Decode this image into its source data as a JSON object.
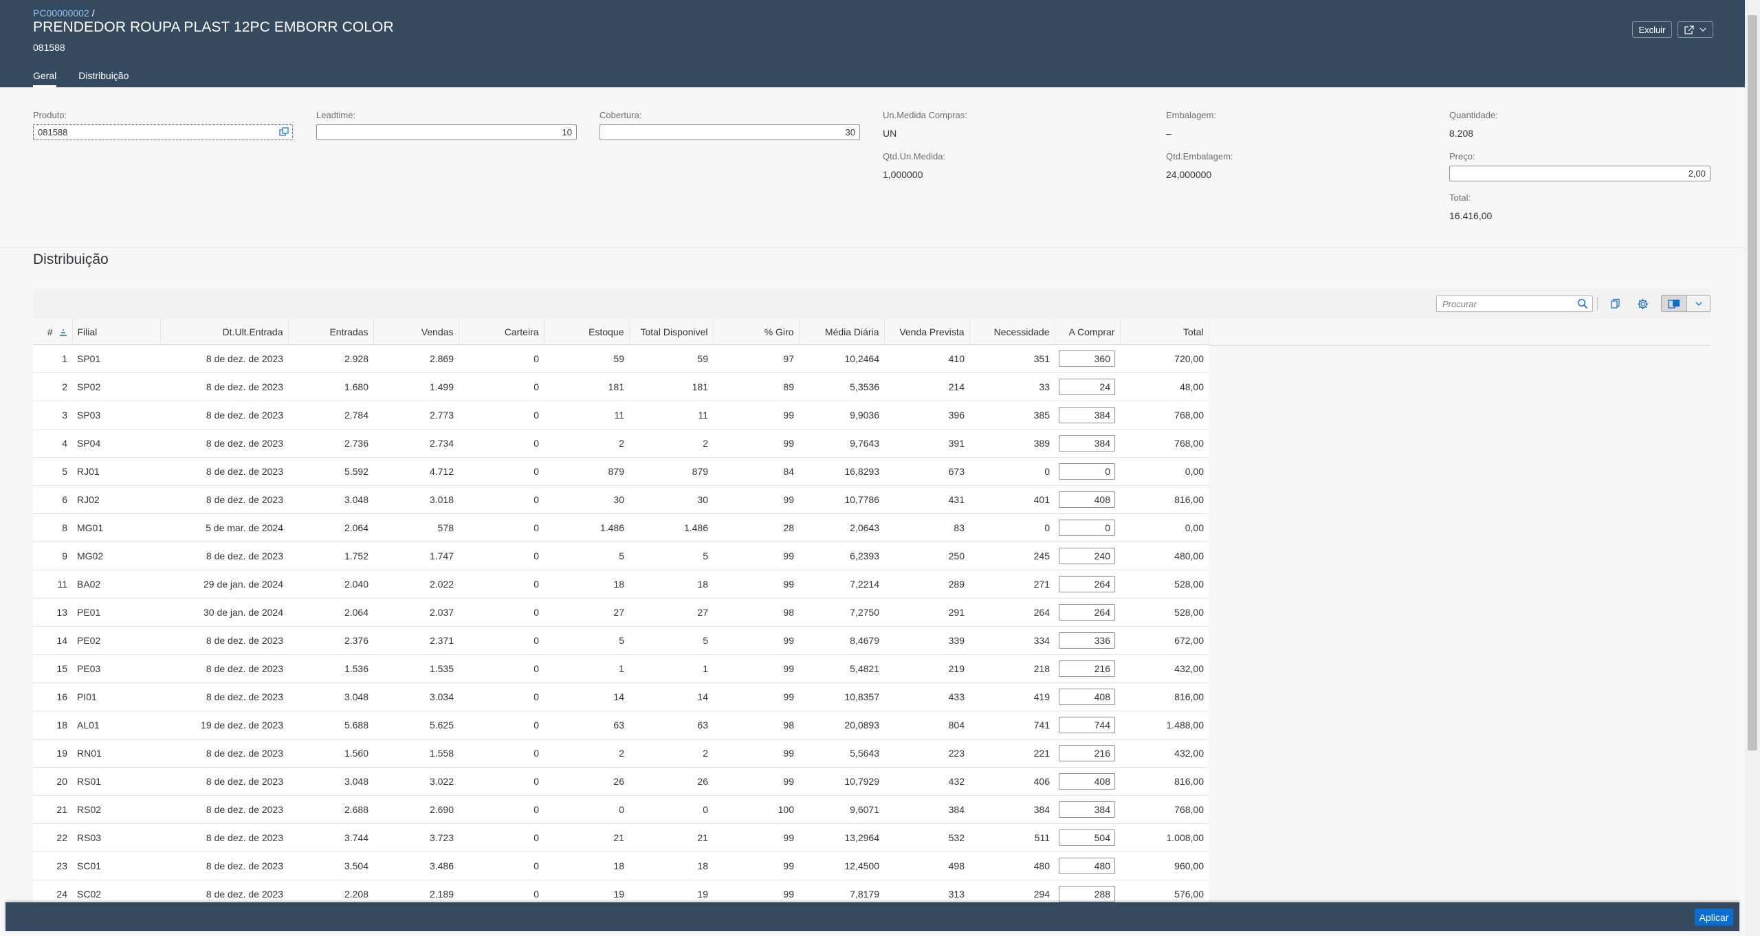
{
  "header": {
    "breadcrumb_link": "PC00000002",
    "breadcrumb_sep": "/",
    "title": "PRENDEDOR ROUPA PLAST 12PC EMBORR COLOR",
    "subtitle": "081588",
    "delete_label": "Excluir",
    "tabs": [
      {
        "label": "Geral"
      },
      {
        "label": "Distribuição"
      }
    ]
  },
  "form": {
    "produto": {
      "label": "Produto:",
      "value": "081588"
    },
    "leadtime": {
      "label": "Leadtime:",
      "value": "10"
    },
    "cobertura": {
      "label": "Cobertura:",
      "value": "30"
    },
    "un_medida_compras": {
      "label": "Un.Medida Compras:",
      "value": "UN"
    },
    "qtd_un_medida": {
      "label": "Qtd.Un.Medida:",
      "value": "1,000000"
    },
    "embalagem": {
      "label": "Embalagem:",
      "value": "–"
    },
    "qtd_embalagem": {
      "label": "Qtd.Embalagem:",
      "value": "24,000000"
    },
    "quantidade": {
      "label": "Quantidade:",
      "value": "8.208"
    },
    "preco": {
      "label": "Preço:",
      "value": "2,00"
    },
    "total": {
      "label": "Total:",
      "value": "16.416,00"
    }
  },
  "section": {
    "title": "Distribuição",
    "search_placeholder": "Procurar"
  },
  "table": {
    "columns": [
      "#",
      "Filial",
      "Dt.Ult.Entrada",
      "Entradas",
      "Vendas",
      "Carteira",
      "Estoque",
      "Total Disponivel",
      "% Giro",
      "Média Diária",
      "Venda Prevista",
      "Necessidade",
      "A Comprar",
      "Total"
    ],
    "rows": [
      [
        "1",
        "SP01",
        "8 de dez. de 2023",
        "2.928",
        "2.869",
        "0",
        "59",
        "59",
        "97",
        "10,2464",
        "410",
        "351",
        "360",
        "720,00"
      ],
      [
        "2",
        "SP02",
        "8 de dez. de 2023",
        "1.680",
        "1.499",
        "0",
        "181",
        "181",
        "89",
        "5,3536",
        "214",
        "33",
        "24",
        "48,00"
      ],
      [
        "3",
        "SP03",
        "8 de dez. de 2023",
        "2.784",
        "2.773",
        "0",
        "11",
        "11",
        "99",
        "9,9036",
        "396",
        "385",
        "384",
        "768,00"
      ],
      [
        "4",
        "SP04",
        "8 de dez. de 2023",
        "2.736",
        "2.734",
        "0",
        "2",
        "2",
        "99",
        "9,7643",
        "391",
        "389",
        "384",
        "768,00"
      ],
      [
        "5",
        "RJ01",
        "8 de dez. de 2023",
        "5.592",
        "4.712",
        "0",
        "879",
        "879",
        "84",
        "16,8293",
        "673",
        "0",
        "0",
        "0,00"
      ],
      [
        "6",
        "RJ02",
        "8 de dez. de 2023",
        "3.048",
        "3.018",
        "0",
        "30",
        "30",
        "99",
        "10,7786",
        "431",
        "401",
        "408",
        "816,00"
      ],
      [
        "8",
        "MG01",
        "5 de mar. de 2024",
        "2.064",
        "578",
        "0",
        "1.486",
        "1.486",
        "28",
        "2,0643",
        "83",
        "0",
        "0",
        "0,00"
      ],
      [
        "9",
        "MG02",
        "8 de dez. de 2023",
        "1.752",
        "1.747",
        "0",
        "5",
        "5",
        "99",
        "6,2393",
        "250",
        "245",
        "240",
        "480,00"
      ],
      [
        "11",
        "BA02",
        "29 de jan. de 2024",
        "2.040",
        "2.022",
        "0",
        "18",
        "18",
        "99",
        "7,2214",
        "289",
        "271",
        "264",
        "528,00"
      ],
      [
        "13",
        "PE01",
        "30 de jan. de 2024",
        "2.064",
        "2.037",
        "0",
        "27",
        "27",
        "98",
        "7,2750",
        "291",
        "264",
        "264",
        "528,00"
      ],
      [
        "14",
        "PE02",
        "8 de dez. de 2023",
        "2.376",
        "2.371",
        "0",
        "5",
        "5",
        "99",
        "8,4679",
        "339",
        "334",
        "336",
        "672,00"
      ],
      [
        "15",
        "PE03",
        "8 de dez. de 2023",
        "1.536",
        "1.535",
        "0",
        "1",
        "1",
        "99",
        "5,4821",
        "219",
        "218",
        "216",
        "432,00"
      ],
      [
        "16",
        "PI01",
        "8 de dez. de 2023",
        "3.048",
        "3.034",
        "0",
        "14",
        "14",
        "99",
        "10,8357",
        "433",
        "419",
        "408",
        "816,00"
      ],
      [
        "18",
        "AL01",
        "19 de dez. de 2023",
        "5.688",
        "5.625",
        "0",
        "63",
        "63",
        "98",
        "20,0893",
        "804",
        "741",
        "744",
        "1.488,00"
      ],
      [
        "19",
        "RN01",
        "8 de dez. de 2023",
        "1.560",
        "1.558",
        "0",
        "2",
        "2",
        "99",
        "5,5643",
        "223",
        "221",
        "216",
        "432,00"
      ],
      [
        "20",
        "RS01",
        "8 de dez. de 2023",
        "3.048",
        "3.022",
        "0",
        "26",
        "26",
        "99",
        "10,7929",
        "432",
        "406",
        "408",
        "816,00"
      ],
      [
        "21",
        "RS02",
        "8 de dez. de 2023",
        "2.688",
        "2.690",
        "0",
        "0",
        "0",
        "100",
        "9,6071",
        "384",
        "384",
        "384",
        "768,00"
      ],
      [
        "22",
        "RS03",
        "8 de dez. de 2023",
        "3.744",
        "3.723",
        "0",
        "21",
        "21",
        "99",
        "13,2964",
        "532",
        "511",
        "504",
        "1.008,00"
      ],
      [
        "23",
        "SC01",
        "8 de dez. de 2023",
        "3.504",
        "3.486",
        "0",
        "18",
        "18",
        "99",
        "12,4500",
        "498",
        "480",
        "480",
        "960,00"
      ],
      [
        "24",
        "SC02",
        "8 de dez. de 2023",
        "2.208",
        "2.189",
        "0",
        "19",
        "19",
        "99",
        "7,8179",
        "313",
        "294",
        "288",
        "576,00"
      ]
    ]
  },
  "footer": {
    "apply_label": "Aplicar"
  },
  "colors": {
    "shell": "#354a5f",
    "accent": "#0a6ed1",
    "link": "#8ec5f3"
  },
  "icons": [
    "value-help-icon",
    "share-icon",
    "chevron-down-icon",
    "search-icon",
    "copy-icon",
    "settings-icon",
    "sort-icon"
  ]
}
